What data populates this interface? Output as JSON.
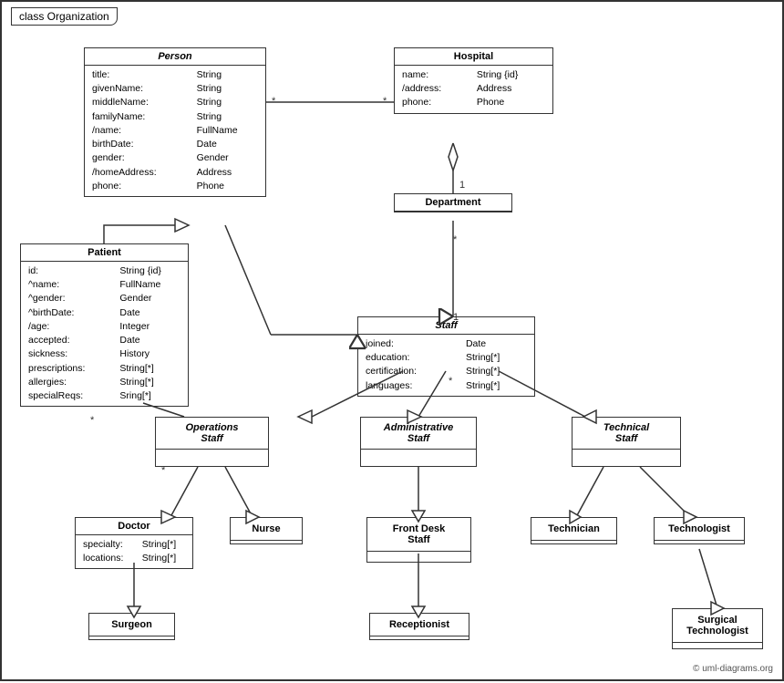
{
  "title": "class Organization",
  "copyright": "© uml-diagrams.org",
  "classes": {
    "person": {
      "name": "Person",
      "attrs": [
        [
          "title:",
          "String"
        ],
        [
          "givenName:",
          "String"
        ],
        [
          "middleName:",
          "String"
        ],
        [
          "familyName:",
          "String"
        ],
        [
          "/name:",
          "FullName"
        ],
        [
          "birthDate:",
          "Date"
        ],
        [
          "gender:",
          "Gender"
        ],
        [
          "/homeAddress:",
          "Address"
        ],
        [
          "phone:",
          "Phone"
        ]
      ]
    },
    "hospital": {
      "name": "Hospital",
      "attrs": [
        [
          "name:",
          "String {id}"
        ],
        [
          "/address:",
          "Address"
        ],
        [
          "phone:",
          "Phone"
        ]
      ]
    },
    "patient": {
      "name": "Patient",
      "attrs": [
        [
          "id:",
          "String {id}"
        ],
        [
          "^name:",
          "FullName"
        ],
        [
          "^gender:",
          "Gender"
        ],
        [
          "^birthDate:",
          "Date"
        ],
        [
          "/age:",
          "Integer"
        ],
        [
          "accepted:",
          "Date"
        ],
        [
          "sickness:",
          "History"
        ],
        [
          "prescriptions:",
          "String[*]"
        ],
        [
          "allergies:",
          "String[*]"
        ],
        [
          "specialReqs:",
          "Sring[*]"
        ]
      ]
    },
    "department": {
      "name": "Department",
      "attrs": []
    },
    "staff": {
      "name": "Staff",
      "attrs": [
        [
          "joined:",
          "Date"
        ],
        [
          "education:",
          "String[*]"
        ],
        [
          "certification:",
          "String[*]"
        ],
        [
          "languages:",
          "String[*]"
        ]
      ]
    },
    "operations_staff": {
      "name": "Operations\nStaff",
      "attrs": []
    },
    "administrative_staff": {
      "name": "Administrative\nStaff",
      "attrs": []
    },
    "technical_staff": {
      "name": "Technical\nStaff",
      "attrs": []
    },
    "doctor": {
      "name": "Doctor",
      "attrs": [
        [
          "specialty:",
          "String[*]"
        ],
        [
          "locations:",
          "String[*]"
        ]
      ]
    },
    "nurse": {
      "name": "Nurse",
      "attrs": []
    },
    "front_desk": {
      "name": "Front Desk\nStaff",
      "attrs": []
    },
    "technician": {
      "name": "Technician",
      "attrs": []
    },
    "technologist": {
      "name": "Technologist",
      "attrs": []
    },
    "surgeon": {
      "name": "Surgeon",
      "attrs": []
    },
    "receptionist": {
      "name": "Receptionist",
      "attrs": []
    },
    "surgical_technologist": {
      "name": "Surgical\nTechnologist",
      "attrs": []
    }
  }
}
